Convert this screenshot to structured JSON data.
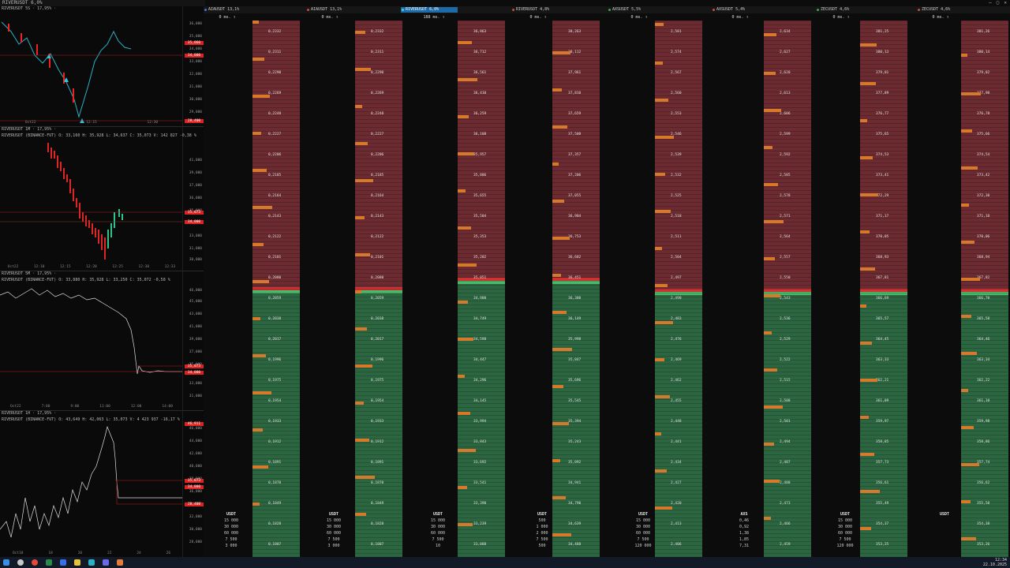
{
  "window": {
    "title": "RIVERUSDT 6,0%",
    "controls": [
      "–",
      "▢",
      "✕"
    ]
  },
  "charts": [
    {
      "header": "RIVERUSDT 5S · 17,95% ·",
      "sub": "RIVERUSDT (BINANCE-FUT)  O: 35,220  H: 35,227  L: 35,213  C: 35,768  -0,47 %",
      "ticks": [
        "36,000",
        "35,000",
        "34,000",
        "33,000",
        "32,000",
        "31,000",
        "30,000",
        "29,000"
      ],
      "price_tags": [
        "35,060",
        "34,000",
        "28,400"
      ],
      "times": [
        "Oct22",
        "12:15",
        "12:30"
      ]
    },
    {
      "header": "RIVERUSDT 1M · 17,95% ·",
      "sub": "RIVERUSDT (BINANCE-FUT)  O: 33,160  H: 35,928  L: 34,637  C: 35,073  V: 142 827  -0,38 %",
      "ticks": [
        "41,000",
        "39,000",
        "37,000",
        "36,000",
        "35,000",
        "34,000",
        "33,000",
        "31,000",
        "30,000"
      ],
      "price_tags": [
        "35,073",
        "34,000"
      ],
      "times": [
        "Oct22",
        "12:10",
        "12:15",
        "12:20",
        "12:25",
        "12:30",
        "12:33"
      ]
    },
    {
      "header": "RIVERUSDT 5M · 17,95% ·",
      "sub": "RIVERUSDT (BINANCE-FUT)  O: 33,880  H: 35,928  L: 33,250  C: 35,072  -0,58 %",
      "ticks": [
        "46,000",
        "45,000",
        "43,000",
        "41,000",
        "39,000",
        "37,000",
        "35,000",
        "33,000",
        "31,000"
      ],
      "price_tags": [
        "35,073",
        "34,000"
      ],
      "times": [
        "Oct22",
        "7:00",
        "9:00",
        "11:00",
        "12:00",
        "14:00"
      ]
    },
    {
      "header": "RIVERUSDT 1H · 17,95% ·",
      "sub": "RIVERUSDT (BINANCE-FUT)  O: 43,649  H: 42,063  L: 35,073  V: 4 423 937  -16,17 %",
      "ticks": [
        "46,000",
        "44,000",
        "42,000",
        "40,000",
        "38,000",
        "36,000",
        "34,000",
        "32,000",
        "30,000",
        "28,000"
      ],
      "price_tags": [
        "46,911",
        "35,073",
        "34,000",
        "28,400"
      ],
      "times": [
        "Oct18",
        "18",
        "20",
        "22",
        "24",
        "26"
      ]
    }
  ],
  "tabs": [
    {
      "label": "AIAUSDT 13,1%",
      "color": "#3a7bd5"
    },
    {
      "label": "AIAUSDT 13,1%",
      "color": "#d54a3a"
    },
    {
      "label": "RIVERUSDT 6,0%",
      "color": "#3ad5d0",
      "active": true
    },
    {
      "label": "RIVERUSDT 4,8%",
      "color": "#d54a3a"
    },
    {
      "label": "AXSUSDT 5,5%",
      "color": "#3aa85a"
    },
    {
      "label": "AXSUSDT 5,4%",
      "color": "#d54a3a"
    },
    {
      "label": "ZECUSDT 4,6%",
      "color": "#3aa85a"
    },
    {
      "label": "ZECUSDT 4,6%",
      "color": "#d54a3a"
    }
  ],
  "columns": [
    {
      "head": "0 ms. ↑",
      "prices": [
        "0,2332",
        "0,2311",
        "0,2290",
        "0,2269",
        "0,2248",
        "0,2227",
        "0,2206",
        "0,2185",
        "0,2164",
        "0,2143",
        "0,2122",
        "0,2101",
        "0,2080",
        "0,2059",
        "0,2038",
        "0,2017",
        "0,1996",
        "0,1975",
        "0,1954",
        "0,1933",
        "0,1912",
        "0,1891",
        "0,1870",
        "0,1849",
        "0,1828",
        "0,1807"
      ],
      "footer": [
        "USDT",
        "15 000",
        "30 000",
        "60 000",
        "7 500",
        "3 000"
      ]
    },
    {
      "head": "0 ms. ↑",
      "prices": [
        "0,2332",
        "0,2311",
        "0,2290",
        "0,2269",
        "0,2248",
        "0,2227",
        "0,2206",
        "0,2185",
        "0,2164",
        "0,2143",
        "0,2122",
        "0,2101",
        "0,2080",
        "0,2059",
        "0,2038",
        "0,2017",
        "0,1996",
        "0,1975",
        "0,1954",
        "0,1933",
        "0,1912",
        "0,1891",
        "0,1870",
        "0,1849",
        "0,1828",
        "0,1807"
      ],
      "footer": [
        "USDT",
        "15 000",
        "30 000",
        "60 000",
        "7 500",
        "3 000"
      ]
    },
    {
      "head": "188 ms. ↑",
      "prices": [
        "36,863",
        "36,712",
        "36,561",
        "36,410",
        "36,259",
        "36,108",
        "35,957",
        "35,806",
        "35,655",
        "35,504",
        "35,353",
        "35,202",
        "35,051",
        "34,900",
        "34,749",
        "34,598",
        "34,447",
        "34,296",
        "34,145",
        "33,994",
        "33,843",
        "33,692",
        "33,541",
        "33,390",
        "33,239",
        "33,088"
      ],
      "footer": [
        "USDT",
        "15 000",
        "30 000",
        "60 000",
        "7 500",
        "10"
      ]
    },
    {
      "head": "0 ms. ↑",
      "prices": [
        "38,263",
        "38,112",
        "37,961",
        "37,810",
        "37,659",
        "37,508",
        "37,357",
        "37,206",
        "37,055",
        "36,904",
        "36,753",
        "36,602",
        "36,451",
        "36,300",
        "36,149",
        "35,998",
        "35,847",
        "35,696",
        "35,545",
        "35,394",
        "35,243",
        "35,092",
        "34,941",
        "34,790",
        "34,639",
        "34,488"
      ],
      "footer": [
        "USDT",
        "500",
        "1 000",
        "2 000",
        "7 500",
        "500"
      ]
    },
    {
      "head": "0 ms. ↑",
      "prices": [
        "2,581",
        "2,574",
        "2,567",
        "2,560",
        "2,553",
        "2,546",
        "2,539",
        "2,532",
        "2,525",
        "2,518",
        "2,511",
        "2,504",
        "2,497",
        "2,490",
        "2,483",
        "2,476",
        "2,469",
        "2,462",
        "2,455",
        "2,448",
        "2,441",
        "2,434",
        "2,427",
        "2,420",
        "2,413",
        "2,406"
      ],
      "footer": [
        "USDT",
        "15 000",
        "30 000",
        "60 000",
        "7 500",
        "120 000"
      ]
    },
    {
      "head": "0 ms. ↑",
      "prices": [
        "2,634",
        "2,627",
        "2,620",
        "2,613",
        "2,606",
        "2,599",
        "2,592",
        "2,585",
        "2,578",
        "2,571",
        "2,564",
        "2,557",
        "2,550",
        "2,543",
        "2,536",
        "2,529",
        "2,522",
        "2,515",
        "2,508",
        "2,501",
        "2,494",
        "2,487",
        "2,480",
        "2,473",
        "2,466",
        "2,459"
      ],
      "footer": [
        "AXS",
        "0,46",
        "0,92",
        "1,38",
        "1,85",
        "7,31"
      ]
    },
    {
      "head": "0 ms. ↑",
      "prices": [
        "381,25",
        "380,13",
        "379,01",
        "377,89",
        "376,77",
        "375,65",
        "374,53",
        "373,41",
        "372,29",
        "371,17",
        "370,05",
        "368,93",
        "367,81",
        "366,69",
        "365,57",
        "364,45",
        "363,33",
        "362,21",
        "361,09",
        "359,97",
        "358,85",
        "357,73",
        "356,61",
        "355,49",
        "354,37",
        "353,25"
      ],
      "footer": [
        "USDT",
        "15 000",
        "30 000",
        "60 000",
        "7 500",
        "120 000"
      ]
    },
    {
      "head": "0 ms. ↑",
      "prices": [
        "381,26",
        "380,14",
        "379,02",
        "377,90",
        "376,78",
        "375,66",
        "374,54",
        "373,42",
        "372,30",
        "371,18",
        "370,06",
        "368,94",
        "367,82",
        "366,70",
        "365,58",
        "364,46",
        "363,34",
        "362,22",
        "361,10",
        "359,98",
        "358,86",
        "357,74",
        "356,62",
        "355,50",
        "354,38",
        "353,26"
      ],
      "footer": [
        "USDT",
        "",
        "",
        "",
        "",
        ""
      ]
    }
  ],
  "clock": {
    "time": "12:34",
    "date": "22.10.2025"
  }
}
